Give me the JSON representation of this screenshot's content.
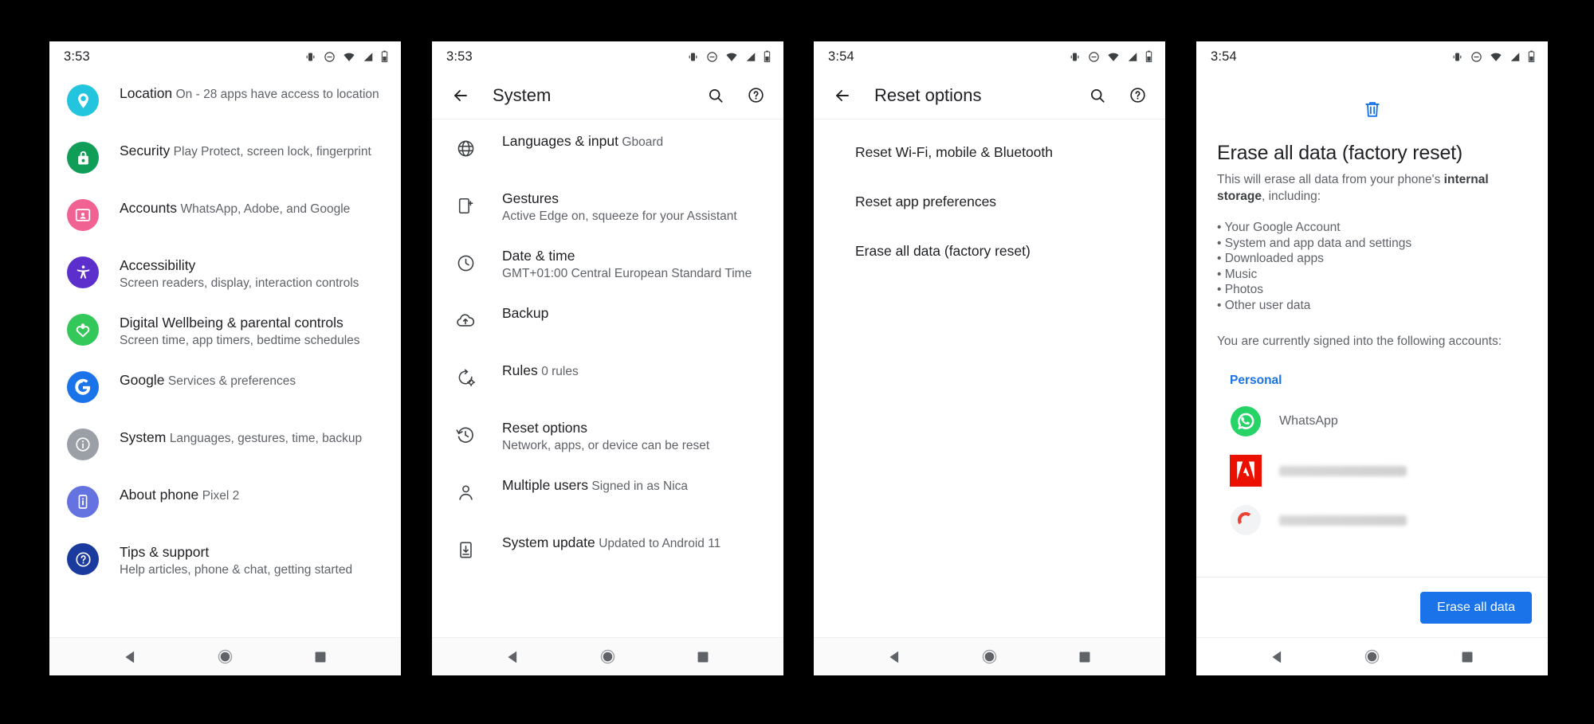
{
  "panels": [
    {
      "id": "settings-main",
      "status": {
        "time": "3:53",
        "icons": [
          "vibrate-icon",
          "do-not-disturb-icon",
          "wifi-icon",
          "signal-icon",
          "battery-icon"
        ]
      },
      "has_appbar": false,
      "list": [
        {
          "title": "Location",
          "sub": "On - 28 apps have access to location",
          "icon": "location-pin-icon",
          "color": "#22c4de"
        },
        {
          "title": "Security",
          "sub": "Play Protect, screen lock, fingerprint",
          "icon": "lock-shield-icon",
          "color": "#0f9d58"
        },
        {
          "title": "Accounts",
          "sub": "WhatsApp, Adobe, and Google",
          "icon": "account-card-icon",
          "color": "#f06292"
        },
        {
          "title": "Accessibility",
          "sub": "Screen readers, display, interaction controls",
          "icon": "accessibility-icon",
          "color": "#5c2ecc"
        },
        {
          "title": "Digital Wellbeing & parental controls",
          "sub": "Screen time, app timers, bedtime schedules",
          "icon": "wellbeing-heart-icon",
          "color": "#34c759"
        },
        {
          "title": "Google",
          "sub": "Services & preferences",
          "icon": "google-g-icon",
          "color": "#1a73e8"
        },
        {
          "title": "System",
          "sub": "Languages, gestures, time, backup",
          "icon": "info-circle-icon",
          "color": "#9aa0a6"
        },
        {
          "title": "About phone",
          "sub": "Pixel 2",
          "icon": "phone-info-icon",
          "color": "#6573e0"
        },
        {
          "title": "Tips & support",
          "sub": "Help articles, phone & chat, getting started",
          "icon": "question-circle-icon",
          "color": "#1a3a9e"
        }
      ]
    },
    {
      "id": "system",
      "status": {
        "time": "3:53"
      },
      "has_appbar": true,
      "appbar": {
        "title": "System",
        "back": "back-arrow-icon",
        "search": "search-icon",
        "help": "help-icon"
      },
      "list": [
        {
          "title": "Languages & input",
          "sub": "Gboard",
          "icon": "globe-icon"
        },
        {
          "title": "Gestures",
          "sub": "Active Edge on, squeeze for your Assistant",
          "icon": "gesture-phone-icon"
        },
        {
          "title": "Date & time",
          "sub": "GMT+01:00 Central European Standard Time",
          "icon": "clock-icon"
        },
        {
          "title": "Backup",
          "sub": "",
          "icon": "cloud-upload-icon"
        },
        {
          "title": "Rules",
          "sub": "0 rules",
          "icon": "rules-gear-icon"
        },
        {
          "title": "Reset options",
          "sub": "Network, apps, or device can be reset",
          "icon": "history-restore-icon"
        },
        {
          "title": "Multiple users",
          "sub": "Signed in as Nica",
          "icon": "person-icon"
        },
        {
          "title": "System update",
          "sub": "Updated to Android 11",
          "icon": "system-update-icon"
        }
      ]
    },
    {
      "id": "reset-options",
      "status": {
        "time": "3:54"
      },
      "has_appbar": true,
      "appbar": {
        "title": "Reset options",
        "back": "back-arrow-icon",
        "search": "search-icon",
        "help": "help-icon"
      },
      "simple_list": [
        "Reset Wi-Fi, mobile & Bluetooth",
        "Reset app preferences",
        "Erase all data (factory reset)"
      ]
    },
    {
      "id": "factory-reset",
      "status": {
        "time": "3:54"
      },
      "has_appbar": false,
      "factory_reset": {
        "icon": "trash-icon",
        "icon_color": "#1a73e8",
        "title": "Erase all data (factory reset)",
        "desc_before": "This will erase all data from your phone's ",
        "desc_bold": "internal storage",
        "desc_after": ", including:",
        "bullets": [
          "• Your Google Account",
          "• System and app data and settings",
          "• Downloaded apps",
          "• Music",
          "• Photos",
          "• Other user data"
        ],
        "accounts_label": "You are currently signed into the following accounts:",
        "group_label": "Personal",
        "group_color": "#1a73e8",
        "accounts": [
          {
            "name": "WhatsApp",
            "icon": "whatsapp-icon",
            "redacted": false
          },
          {
            "name": "",
            "icon": "adobe-icon",
            "redacted": true
          },
          {
            "name": "",
            "icon": "gmail-icon",
            "redacted": true
          }
        ],
        "button_label": "Erase all data",
        "button_color": "#1a73e8"
      }
    }
  ],
  "navbar": {
    "back": "nav-back-icon",
    "home": "nav-home-icon",
    "recents": "nav-recents-icon"
  }
}
